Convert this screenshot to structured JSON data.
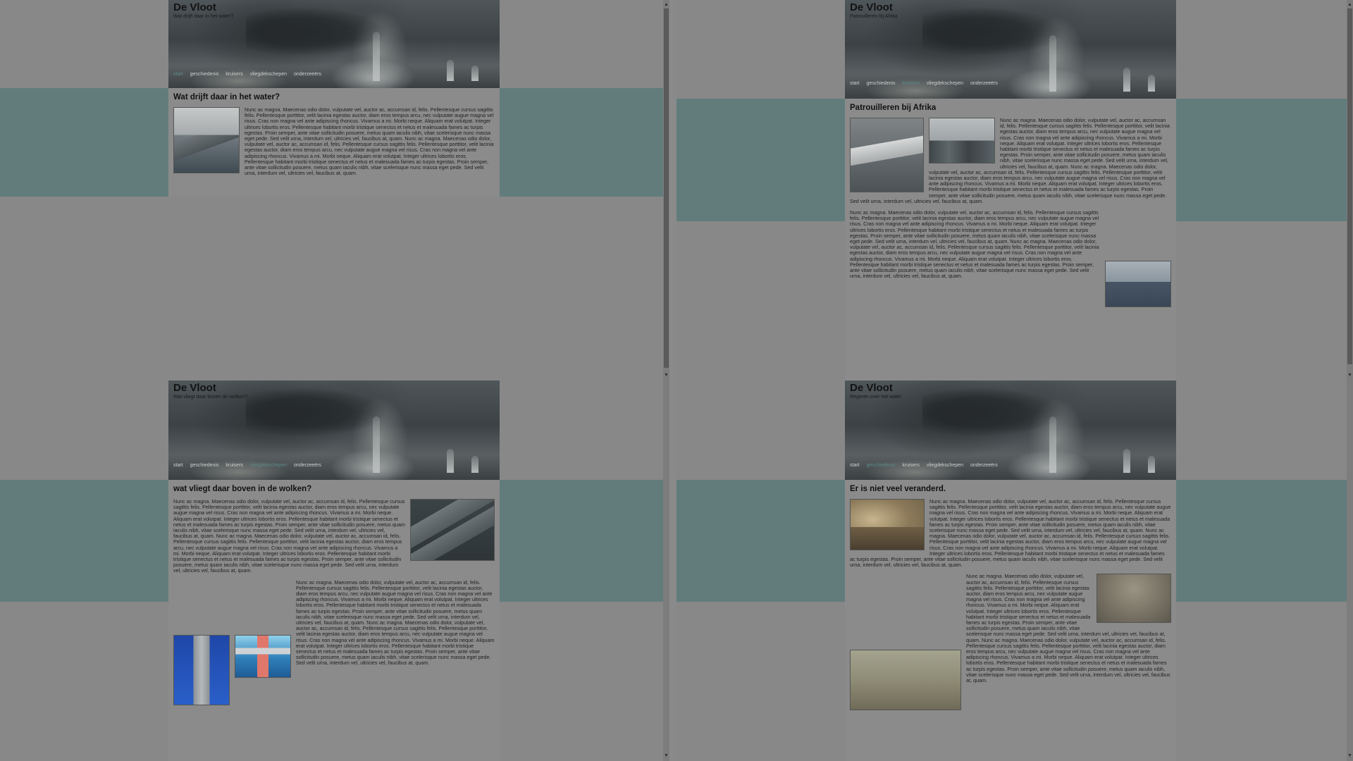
{
  "site_title": "De Vloot",
  "nav": [
    "start",
    "geschiedenis",
    "kruisers",
    "vliegdekschepen",
    "onderzeeërs"
  ],
  "panes": [
    {
      "subtitle": "Wat drijft daar in het water?",
      "heading": "Wat drijft daar in het water?",
      "paragraphs": [
        "Nunc ac magna. Maecenas odio dolor, vulputate vel, auctor ac, accumsan id, felis. Pellentesque cursus sagittis felis. Pellentesque porttitor, velit lacinia egestas auctor, diam eros tempus arcu, nec vulputate augue magna vel risus. Cras non magna vel ante adipiscing rhoncus. Vivamus a mi. Morbi neque. Aliquam erat volutpat. Integer ultrices lobortis eros. Pellentesque habitant morbi tristique senectus et netus et malesuada fames ac turpis egestas. Proin semper, ante vitae sollicitudin posuere, metus quam iaculis nibh, vitae scelerisque nunc massa eget pede. Sed velit urna, interdum vel, ultricies vel, faucibus at, quam. Nunc ac magna. Maecenas odio dolor, vulputate vel, auctor ac, accumsan id, felis. Pellentesque cursus sagittis felis. Pellentesque porttitor, velit lacinia egestas auctor, diam eros tempus arcu, nec vulputate augue magna vel risus. Cras non magna vel ante adipiscing rhoncus. Vivamus a mi. Morbi neque. Aliquam erat volutpat. Integer ultrices lobortis eros. Pellentesque habitant morbi tristique senectus et netus et malesuada fames ac turpis egestas. Proin semper, ante vitae sollicitudin posuere, metus quam iaculis nibh, vitae scelerisque nunc massa eget pede. Sed velit urna, interdum vel, ultricies vel, faucibus at, quam."
      ]
    },
    {
      "subtitle": "Patrouilleren bij Afrika",
      "heading": "Patrouilleren bij Afrika",
      "paragraphs": [
        "Nunc ac magna. Maecenas odio dolor, vulputate vel, auctor ac, accumsan id, felis. Pellentesque cursus sagittis felis. Pellentesque porttitor, velit lacinia egestas auctor, diam eros tempus arcu, nec vulputate augue magna vel risus. Cras non magna vel ante adipiscing rhoncus. Vivamus a mi. Morbi neque. Aliquam erat volutpat. Integer ultrices lobortis eros. Pellentesque habitant morbi tristique senectus et netus et malesuada fames ac turpis egestas. Proin semper, ante vitae sollicitudin posuere, metus quam iaculis nibh, vitae scelerisque nunc massa eget pede. Sed velit urna, interdum vel, ultricies vel, faucibus at, quam. Nunc ac magna. Maecenas odio dolor, vulputate vel, auctor ac, accumsan id, felis. Pellentesque cursus sagittis felis. Pellentesque porttitor, velit lacinia egestas auctor, diam eros tempus arcu, nec vulputate augue magna vel risus. Cras non magna vel ante adipiscing rhoncus. Vivamus a mi. Morbi neque. Aliquam erat volutpat. Integer ultrices lobortis eros. Pellentesque habitant morbi tristique senectus et netus et malesuada fames ac turpis egestas. Proin semper, ante vitae sollicitudin posuere, metus quam iaculis nibh, vitae scelerisque nunc massa eget pede. Sed velit urna, interdum vel, ultricies vel, faucibus at, quam.",
        "Nunc ac magna. Maecenas odio dolor, vulputate vel, auctor ac, accumsan id, felis. Pellentesque cursus sagittis felis. Pellentesque porttitor, velit lacinia egestas auctor, diam eros tempus arcu, nec vulputate augue magna vel risus. Cras non magna vel ante adipiscing rhoncus. Vivamus a mi. Morbi neque. Aliquam erat volutpat. Integer ultrices lobortis eros. Pellentesque habitant morbi tristique senectus et netus et malesuada fames ac turpis egestas. Proin semper, ante vitae sollicitudin posuere, metus quam iaculis nibh, vitae scelerisque nunc massa eget pede. Sed velit urna, interdum vel, ultricies vel, faucibus at, quam. Nunc ac magna. Maecenas odio dolor, vulputate vel, auctor ac, accumsan id, felis. Pellentesque cursus sagittis felis. Pellentesque porttitor, velit lacinia egestas auctor, diam eros tempus arcu, nec vulputate augue magna vel risus. Cras non magna vel ante adipiscing rhoncus. Vivamus a mi. Morbi neque. Aliquam erat volutpat. Integer ultrices lobortis eros. Pellentesque habitant morbi tristique senectus et netus et malesuada fames ac turpis egestas. Proin semper, ante vitae sollicitudin posuere, metus quam iaculis nibh, vitae scelerisque nunc massa eget pede. Sed velit urna, interdum vel, ultricies vel, faucibus at, quam."
      ]
    },
    {
      "subtitle": "Wat vliegt daar boven de wolken?",
      "heading": "wat vliegt daar boven in de wolken?",
      "paragraphs": [
        "Nunc ac magna. Maecenas odio dolor, vulputate vel, auctor ac, accumsan id, felis. Pellentesque cursus sagittis felis. Pellentesque porttitor, velit lacinia egestas auctor, diam eros tempus arcu, nec vulputate augue magna vel risus. Cras non magna vel ante adipiscing rhoncus. Vivamus a mi. Morbi neque. Aliquam erat volutpat. Integer ultrices lobortis eros. Pellentesque habitant morbi tristique senectus et netus et malesuada fames ac turpis egestas. Proin semper, ante vitae sollicitudin posuere, metus quam iaculis nibh, vitae scelerisque nunc massa eget pede. Sed velit urna, interdum vel, ultricies vel, faucibus at, quam. Nunc ac magna. Maecenas odio dolor, vulputate vel, auctor ac, accumsan id, felis. Pellentesque cursus sagittis felis. Pellentesque porttitor, velit lacinia egestas auctor, diam eros tempus arcu, nec vulputate augue magna vel risus. Cras non magna vel ante adipiscing rhoncus. Vivamus a mi. Morbi neque. Aliquam erat volutpat. Integer ultrices lobortis eros. Pellentesque habitant morbi tristique senectus et netus et malesuada fames ac turpis egestas. Proin semper, ante vitae sollicitudin posuere, metus quam iaculis nibh, vitae scelerisque nunc massa eget pede. Sed velit urna, interdum vel, ultricies vel, faucibus at, quam.",
        "Nunc ac magna. Maecenas odio dolor, vulputate vel, auctor ac, accumsan id, felis. Pellentesque cursus sagittis felis. Pellentesque porttitor, velit lacinia egestas auctor, diam eros tempus arcu, nec vulputate augue magna vel risus. Cras non magna vel ante adipiscing rhoncus. Vivamus a mi. Morbi neque. Aliquam erat volutpat. Integer ultrices lobortis eros. Pellentesque habitant morbi tristique senectus et netus et malesuada fames ac turpis egestas. Proin semper, ante vitae sollicitudin posuere, metus quam iaculis nibh, vitae scelerisque nunc massa eget pede. Sed velit urna, interdum vel, ultricies vel, faucibus at, quam. Nunc ac magna. Maecenas odio dolor, vulputate vel, auctor ac, accumsan id, felis. Pellentesque cursus sagittis felis. Pellentesque porttitor, velit lacinia egestas auctor, diam eros tempus arcu, nec vulputate augue magna vel risus. Cras non magna vel ante adipiscing rhoncus. Vivamus a mi. Morbi neque. Aliquam erat volutpat. Integer ultrices lobortis eros. Pellentesque habitant morbi tristique senectus et netus et malesuada fames ac turpis egestas. Proin semper, ante vitae sollicitudin posuere, metus quam iaculis nibh, vitae scelerisque nunc massa eget pede. Sed velit urna, interdum vel, ultricies vel, faucibus at, quam."
      ]
    },
    {
      "subtitle": "Regeren over het water",
      "heading": "Er is niet veel veranderd.",
      "paragraphs": [
        "Nunc ac magna. Maecenas odio dolor, vulputate vel, auctor ac, accumsan id, felis. Pellentesque cursus sagittis felis. Pellentesque porttitor, velit lacinia egestas auctor, diam eros tempus arcu, nec vulputate augue magna vel risus. Cras non magna vel ante adipiscing rhoncus. Vivamus a mi. Morbi neque. Aliquam erat volutpat. Integer ultrices lobortis eros. Pellentesque habitant morbi tristique senectus et netus et malesuada fames ac turpis egestas. Proin semper, ante vitae sollicitudin posuere, metus quam iaculis nibh, vitae scelerisque nunc massa eget pede. Sed velit urna, interdum vel, ultricies vel, faucibus at, quam. Nunc ac magna. Maecenas odio dolor, vulputate vel, auctor ac, accumsan id, felis. Pellentesque cursus sagittis felis. Pellentesque porttitor, velit lacinia egestas auctor, diam eros tempus arcu, nec vulputate augue magna vel risus. Cras non magna vel ante adipiscing rhoncus. Vivamus a mi. Morbi neque. Aliquam erat volutpat. Integer ultrices lobortis eros. Pellentesque habitant morbi tristique senectus et netus et malesuada fames ac turpis egestas. Proin semper, ante vitae sollicitudin posuere, metus quam iaculis nibh, vitae scelerisque nunc massa eget pede. Sed velit urna, interdum vel, ultricies vel, faucibus at, quam.",
        "Nunc ac magna. Maecenas odio dolor, vulputate vel, auctor ac, accumsan id, felis. Pellentesque cursus sagittis felis. Pellentesque porttitor, velit lacinia egestas auctor, diam eros tempus arcu, nec vulputate augue magna vel risus. Cras non magna vel ante adipiscing rhoncus. Vivamus a mi. Morbi neque. Aliquam erat volutpat. Integer ultrices lobortis eros. Pellentesque habitant morbi tristique senectus et netus et malesuada fames ac turpis egestas. Proin semper, ante vitae sollicitudin posuere, metus quam iaculis nibh, vitae scelerisque nunc massa eget pede. Sed velit urna, interdum vel, ultricies vel, faucibus at, quam. Nunc ac magna. Maecenas odio dolor, vulputate vel, auctor ac, accumsan id, felis. Pellentesque cursus sagittis felis. Pellentesque porttitor, velit lacinia egestas auctor, diam eros tempus arcu, nec vulputate augue magna vel risus. Cras non magna vel ante adipiscing rhoncus. Vivamus a mi. Morbi neque. Aliquam erat volutpat. Integer ultrices lobortis eros. Pellentesque habitant morbi tristique senectus et netus et malesuada fames ac turpis egestas. Proin semper, ante vitae sollicitudin posuere, metus quam iaculis nibh, vitae scelerisque nunc massa eget pede. Sed velit urna, interdum vel, ultricies vel, faucibus at, quam."
      ]
    }
  ]
}
